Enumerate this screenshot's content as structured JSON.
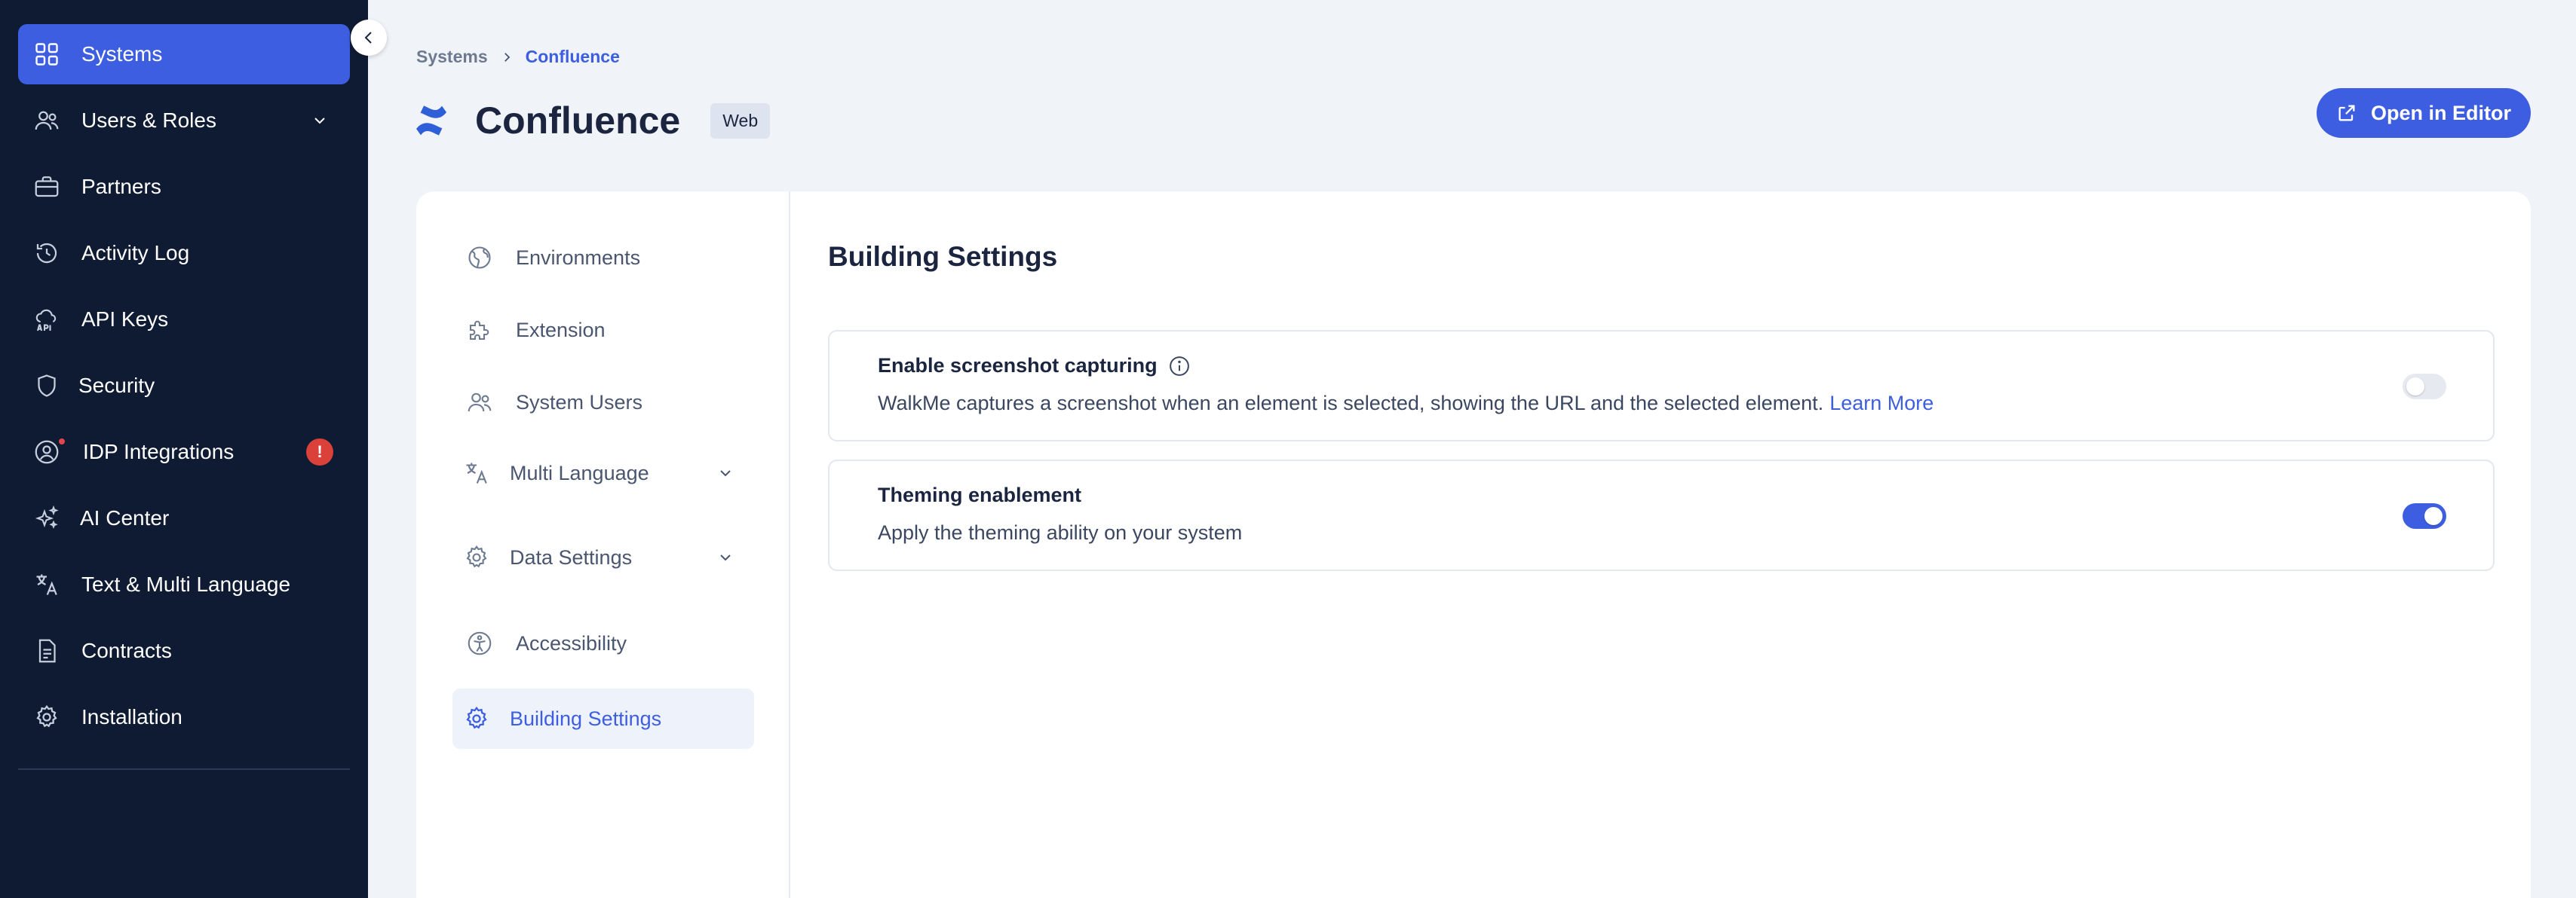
{
  "sidebar": {
    "items": [
      {
        "label": "Systems",
        "icon": "grid-icon",
        "active": true
      },
      {
        "label": "Users & Roles",
        "icon": "users-icon",
        "expandable": true
      },
      {
        "label": "Partners",
        "icon": "briefcase-icon"
      },
      {
        "label": "Activity Log",
        "icon": "history-icon"
      },
      {
        "label": "API Keys",
        "icon": "api-cloud-icon"
      },
      {
        "label": "Security",
        "icon": "shield-icon"
      },
      {
        "label": "IDP Integrations",
        "icon": "idp-user-icon",
        "badge": "!"
      },
      {
        "label": "AI Center",
        "icon": "sparkles-icon"
      },
      {
        "label": "Text & Multi Language",
        "icon": "translate-icon"
      },
      {
        "label": "Contracts",
        "icon": "document-icon"
      },
      {
        "label": "Installation",
        "icon": "gear-icon"
      }
    ]
  },
  "breadcrumb": {
    "parent": "Systems",
    "current": "Confluence"
  },
  "header": {
    "title": "Confluence",
    "type_badge": "Web",
    "open_editor_label": "Open in Editor"
  },
  "subnav": {
    "items": [
      {
        "label": "Environments",
        "icon": "globe-icon"
      },
      {
        "label": "Extension",
        "icon": "puzzle-icon"
      },
      {
        "label": "System Users",
        "icon": "users-icon"
      },
      {
        "label": "Multi Language",
        "icon": "translate-icon",
        "expandable": true
      },
      {
        "label": "Data Settings",
        "icon": "gear-icon",
        "expandable": true
      },
      {
        "label": "Accessibility",
        "icon": "accessibility-icon"
      },
      {
        "label": "Building Settings",
        "icon": "gear-icon",
        "active": true
      }
    ]
  },
  "content": {
    "title": "Building Settings",
    "settings": [
      {
        "title": "Enable screenshot capturing",
        "description": "WalkMe captures a screenshot when an element is selected, showing the URL and the selected element.",
        "link": "Learn More",
        "enabled": false
      },
      {
        "title": "Theming enablement",
        "description": "Apply the theming ability on your system",
        "enabled": true
      }
    ]
  },
  "colors": {
    "sidebar_bg": "#0f1a33",
    "accent": "#3d5ee1",
    "page_bg": "#f0f3f8",
    "badge_red": "#d9413a"
  }
}
